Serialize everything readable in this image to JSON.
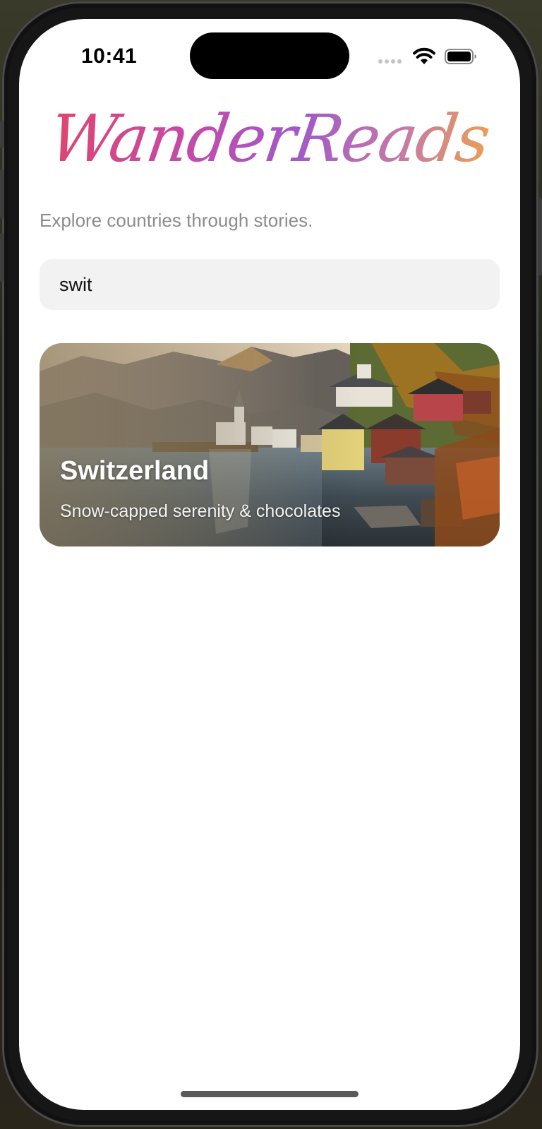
{
  "status_bar": {
    "time": "10:41",
    "icons": [
      "signal-dots-icon",
      "wifi-icon",
      "battery-icon"
    ]
  },
  "app": {
    "title": "WanderReads",
    "subtitle": "Explore countries through stories.",
    "title_gradient": [
      "#e0456e",
      "#a159c7",
      "#f0a44a"
    ]
  },
  "search": {
    "value": "swit"
  },
  "results": [
    {
      "country": "Switzerland",
      "tagline": "Snow-capped serenity & chocolates"
    }
  ]
}
